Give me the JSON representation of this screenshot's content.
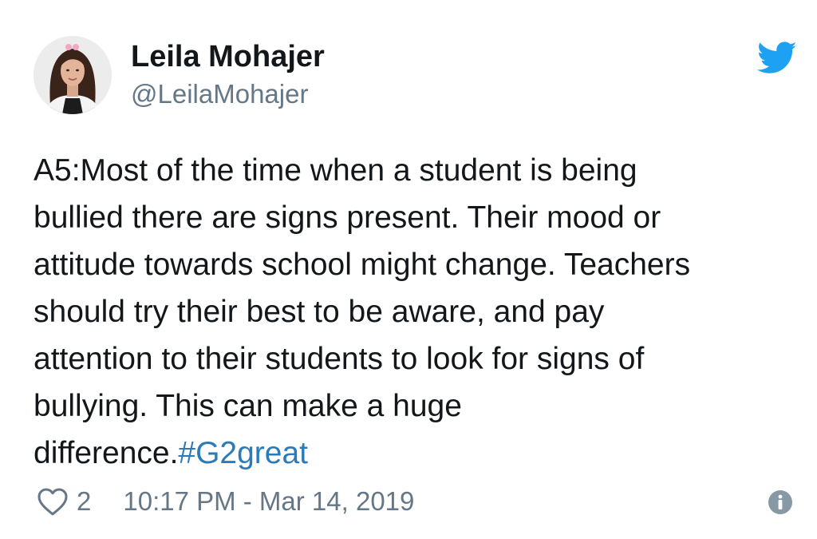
{
  "tweet": {
    "display_name": "Leila Mohajer",
    "handle": "@LeilaMohajer",
    "text_lines": [
      "A5:Most of the time when a student is being",
      "bullied there are signs present. Their mood or",
      "attitude towards school might change. Teachers",
      "should try their best to be aware, and pay",
      "attention to their students to look for signs of",
      "bullying. This can make a huge"
    ],
    "last_line_prefix": "difference.",
    "hashtag": "#G2great",
    "like_count": "2",
    "timestamp": "10:17 PM - Mar 14, 2019"
  },
  "icons": {
    "brand": "twitter-bird-icon",
    "like": "heart-outline-icon",
    "info": "info-icon"
  },
  "colors": {
    "brand_blue": "#1da1f2",
    "hashtag_blue": "#2b7bb9",
    "secondary_text": "#657786",
    "primary_text": "#14171a"
  }
}
